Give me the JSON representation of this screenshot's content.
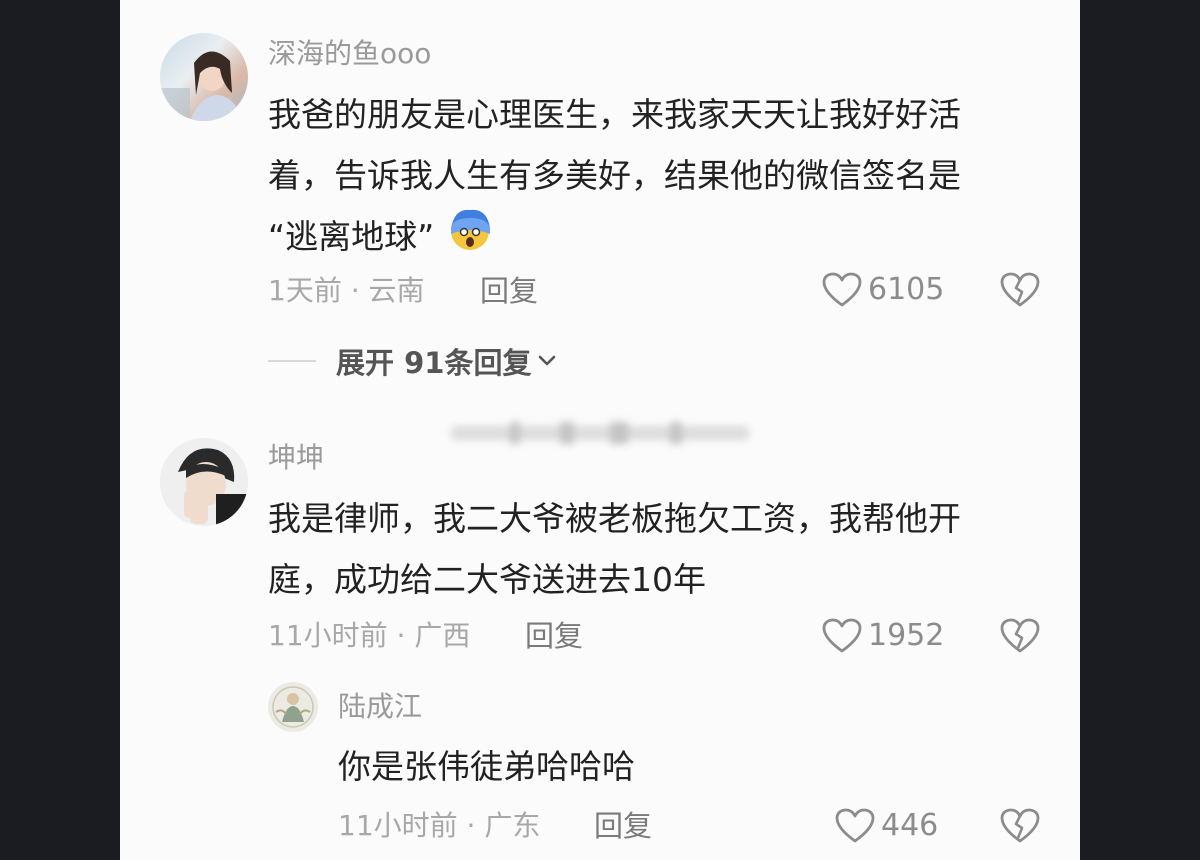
{
  "comments": [
    {
      "username": "深海的鱼ooo",
      "text_line1": "我爸的朋友是心理医生，来我家天天让我好好活",
      "text_line2": "着，告诉我人生有多美好，结果他的微信签名是",
      "text_line3": "“逃离地球”",
      "meta": "1天前 · 云南",
      "reply_label": "回复",
      "likes": "6105",
      "expand_label": "展开 91条回复"
    },
    {
      "username": "坤坤",
      "text_line1": "我是律师，我二大爷被老板拖欠工资，我帮他开",
      "text_line2": "庭，成功给二大爷送进去10年",
      "meta": "11小时前 · 广西",
      "reply_label": "回复",
      "likes": "1952"
    }
  ],
  "subreply": {
    "username": "陆成江",
    "text": "你是张伟徒弟哈哈哈",
    "meta": "11小时前 · 广东",
    "reply_label": "回复",
    "likes": "446"
  },
  "icons": [
    "heart-icon",
    "broken-heart-icon",
    "chevron-down-icon",
    "scared-emoji-icon"
  ],
  "colors": {
    "background": "#fbfbfb",
    "frame": "#1b1c22",
    "text": "#222222",
    "muted": "#9a9a9a"
  }
}
